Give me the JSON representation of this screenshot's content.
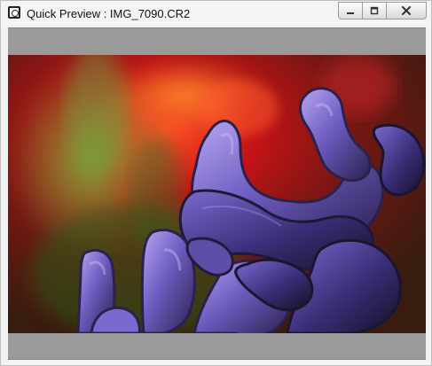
{
  "window": {
    "title": "Quick Preview : IMG_7090.CR2"
  },
  "preview": {
    "subject": "Purple hyacinth close-up"
  },
  "icons": {
    "app": "camera-icon",
    "minimize": "minimize-icon",
    "maximize": "maximize-icon",
    "close": "close-icon"
  },
  "colors": {
    "titlebar": "#f4f4f4",
    "frame": "#f3f3f3",
    "preview_band": "#9a9a9a",
    "flower_purple": "#4b3b8f",
    "background_red": "#b71818",
    "background_green": "#5a8c26"
  }
}
